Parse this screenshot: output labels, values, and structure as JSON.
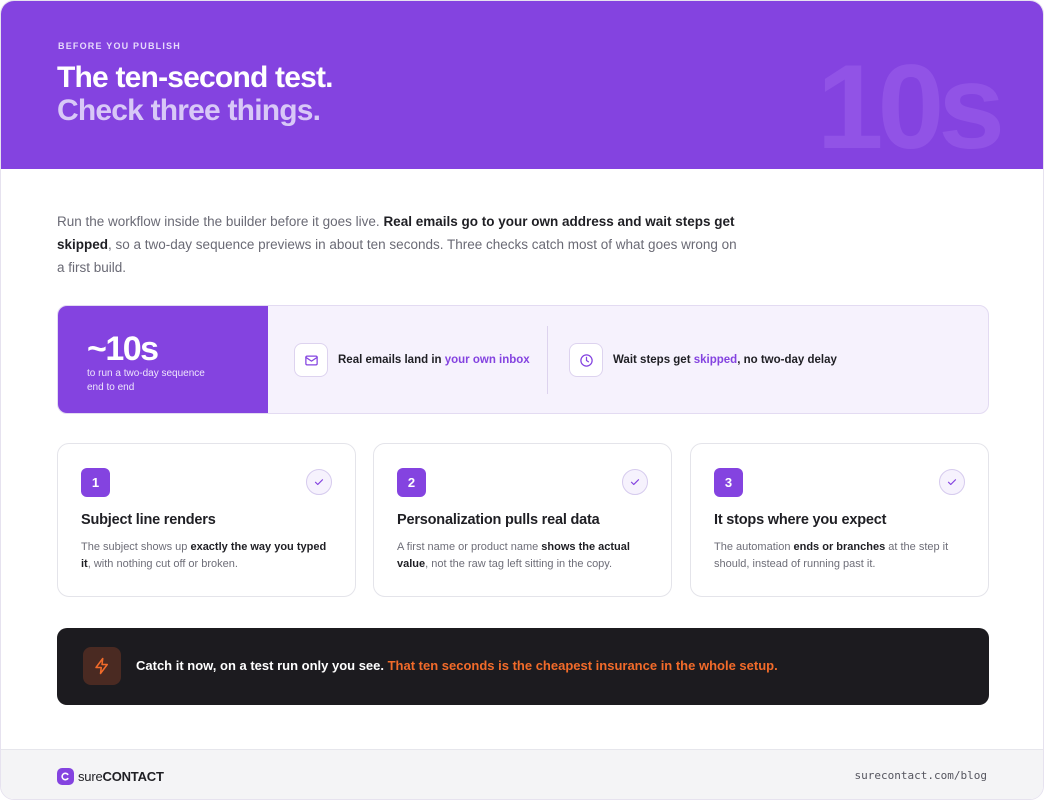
{
  "header": {
    "eyebrow": "BEFORE YOU PUBLISH",
    "title_line1": "The ten-second test.",
    "title_line2": "Check three things.",
    "watermark": "10s",
    "bg_color": "#8443e0"
  },
  "intro": {
    "part1": "Run the workflow inside the builder before it goes live. ",
    "bold": "Real emails go to your own address and wait steps get skipped",
    "part2": ", so a two-day sequence previews in about ten seconds. Three checks catch most of what goes wrong on a first build."
  },
  "stats": {
    "big": "~10s",
    "sub": "to run a two-day sequence end to end",
    "features": [
      {
        "icon": "mail-icon",
        "text_before": "Real emails land in ",
        "highlight": "your own inbox",
        "text_after": ""
      },
      {
        "icon": "clock-icon",
        "text_before": "Wait steps get ",
        "highlight": "skipped",
        "text_after": ", no two-day delay"
      }
    ]
  },
  "checks": [
    {
      "number": "1",
      "title": "Subject line renders",
      "body_before": "The subject shows up ",
      "body_bold": "exactly the way you typed it",
      "body_after": ", with nothing cut off or broken."
    },
    {
      "number": "2",
      "title": "Personalization pulls real data",
      "body_before": "A first name or product name ",
      "body_bold": "shows the actual value",
      "body_after": ", not the raw tag left sitting in the copy."
    },
    {
      "number": "3",
      "title": "It stops where you expect",
      "body_before": "The automation ",
      "body_bold": "ends or branches",
      "body_after": " at the step it should, instead of running past it."
    }
  ],
  "callout": {
    "icon": "lightning-icon",
    "text": "Catch it now, on a test run only you see. ",
    "highlight": "That ten seconds is the cheapest insurance in the whole setup.",
    "accent_color": "#f26b2a"
  },
  "footer": {
    "logo_word1": "sure",
    "logo_word2": "CONTACT",
    "url": "surecontact.com/blog"
  }
}
